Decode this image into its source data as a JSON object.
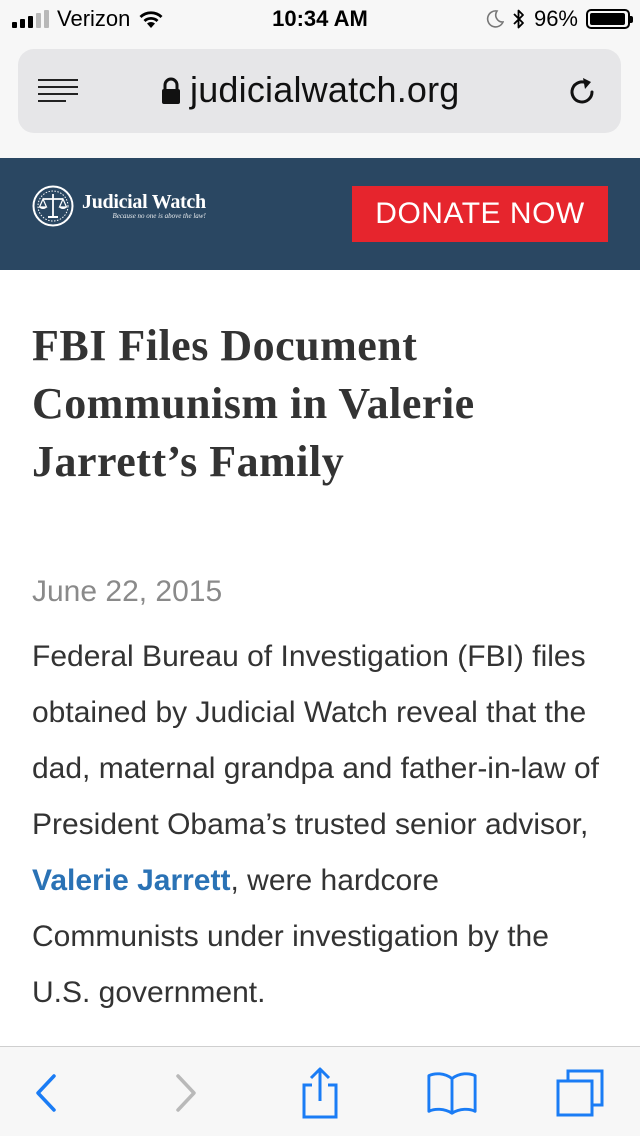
{
  "status_bar": {
    "carrier": "Verizon",
    "time": "10:34 AM",
    "battery_percent_label": "96%",
    "battery_level": 0.96,
    "signal_bars_active": 3,
    "signal_bars_total": 5
  },
  "browser": {
    "url": "judicialwatch.org"
  },
  "site_header": {
    "logo_name": "Judicial Watch",
    "logo_tagline": "Because no one is above the law!",
    "donate_label": "DONATE NOW",
    "header_color": "#2a4762",
    "donate_color": "#e6252d"
  },
  "article": {
    "headline": "FBI Files Document Communism in Valerie Jarrett’s Family",
    "date": "June 22, 2015",
    "body_before_link": "Federal Bureau of Investigation (FBI) files obtained by Judicial Watch reveal that the dad, maternal grandpa and father-in-law of President Obama’s trusted senior advisor, ",
    "body_link": "Valerie Jarrett",
    "body_after_link": ", were hardcore Communists under investigation by the U.S. government.",
    "link_color": "#2a72b5"
  },
  "toolbar": {
    "icons": [
      "back-icon",
      "forward-icon",
      "share-icon",
      "bookmarks-icon",
      "tabs-icon"
    ],
    "accent_color": "#1a7cf5"
  }
}
